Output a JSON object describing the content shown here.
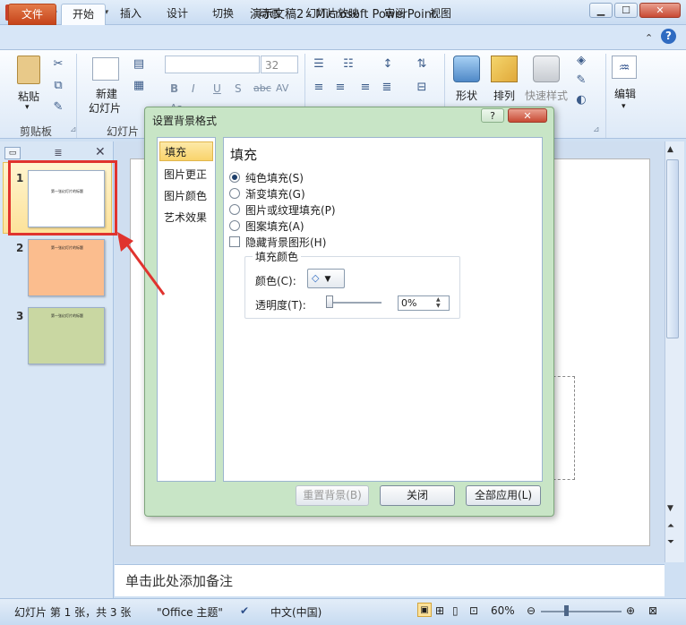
{
  "window": {
    "title": "演示文稿2 - Microsoft PowerPoint"
  },
  "ribbon_tabs": [
    "文件",
    "开始",
    "插入",
    "设计",
    "切换",
    "动画",
    "幻灯片放映",
    "审阅",
    "视图"
  ],
  "ribbon": {
    "paste_label": "粘贴",
    "new_slide_label_1": "新建",
    "new_slide_label_2": "幻灯片",
    "font_size": "32",
    "shape_label": "形状",
    "arrange_label": "排列",
    "quick_style_label": "快速样式",
    "edit_label": "编辑",
    "groups": {
      "clipboard": "剪贴板",
      "slides": "幻灯片"
    }
  },
  "slides_panel": {
    "slides": [
      {
        "num": "1",
        "color": "#ffffff",
        "text": "第一张幻灯片的标题"
      },
      {
        "num": "2",
        "color": "#fbbd8e",
        "text": "第一张幻灯片的标题"
      },
      {
        "num": "3",
        "color": "#c9d7a2",
        "text": "第一张幻灯片的标题"
      }
    ]
  },
  "notes_placeholder": "单击此处添加备注",
  "status": {
    "slide_info": "幻灯片 第 1 张，共 3 张",
    "theme": "\"Office 主题\"",
    "language": "中文(中国)",
    "zoom": "60%"
  },
  "dialog": {
    "title": "设置背景格式",
    "help_label": "?",
    "close_label": "✕",
    "nav": [
      "填充",
      "图片更正",
      "图片颜色",
      "艺术效果"
    ],
    "section_title": "填充",
    "options": [
      {
        "label": "纯色填充(S)",
        "selected": true
      },
      {
        "label": "渐变填充(G)",
        "selected": false
      },
      {
        "label": "图片或纹理填充(P)",
        "selected": false
      },
      {
        "label": "图案填充(A)",
        "selected": false
      }
    ],
    "hide_bg_label": "隐藏背景图形(H)",
    "fill_color_title": "填充颜色",
    "color_label": "颜色(C):",
    "transparency_label": "透明度(T):",
    "transparency_value": "0%",
    "reset_label": "重置背景(B)",
    "close_btn_label": "关闭",
    "apply_all_label": "全部应用(L)"
  },
  "colors": {
    "file_tab": "#d2532a",
    "dialog_bg": "#c8e5c6",
    "annotation": "#e0332e"
  }
}
